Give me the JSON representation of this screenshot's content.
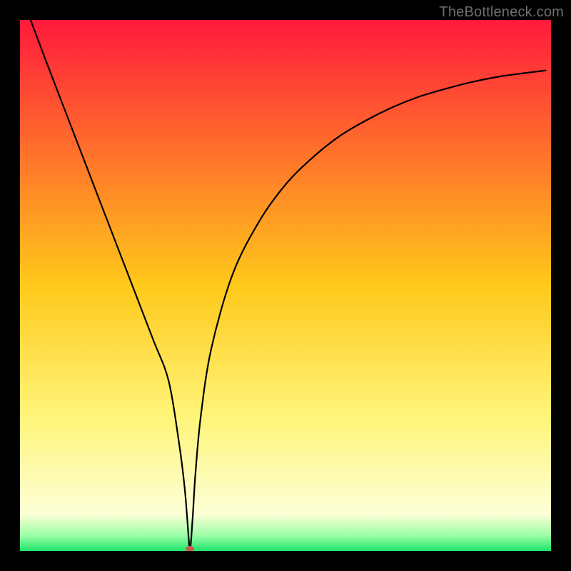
{
  "watermark": "TheBottleneck.com",
  "chart_data": {
    "type": "line",
    "title": "",
    "xlabel": "",
    "ylabel": "",
    "xlim": [
      0,
      100
    ],
    "ylim": [
      0,
      100
    ],
    "grid": false,
    "background_gradient": [
      {
        "pos": 0.0,
        "color": "#ff1a3c"
      },
      {
        "pos": 0.5,
        "color": "#ffc91a"
      },
      {
        "pos": 0.75,
        "color": "#fff57a"
      },
      {
        "pos": 0.93,
        "color": "#fdffd6"
      },
      {
        "pos": 0.97,
        "color": "#9effa8"
      },
      {
        "pos": 1.0,
        "color": "#1de36a"
      }
    ],
    "series": [
      {
        "name": "bottleneck-curve",
        "color": "#000000",
        "x": [
          2,
          5,
          10,
          15,
          20,
          25,
          28,
          30,
          31,
          31.5,
          32,
          32.5,
          33,
          34,
          36,
          40,
          45,
          50,
          55,
          60,
          65,
          70,
          75,
          80,
          85,
          90,
          95,
          99
        ],
        "y": [
          100,
          92,
          79,
          66,
          53,
          40,
          32,
          20,
          12,
          6,
          0.5,
          6,
          14,
          25,
          38,
          52,
          62,
          69,
          74,
          78,
          81,
          83.5,
          85.5,
          87,
          88.3,
          89.3,
          90,
          90.5
        ]
      }
    ],
    "marker": {
      "name": "optimal-point",
      "x": 32,
      "y": 0.4,
      "color": "#c45a4a",
      "rx": 6,
      "ry": 4
    }
  }
}
